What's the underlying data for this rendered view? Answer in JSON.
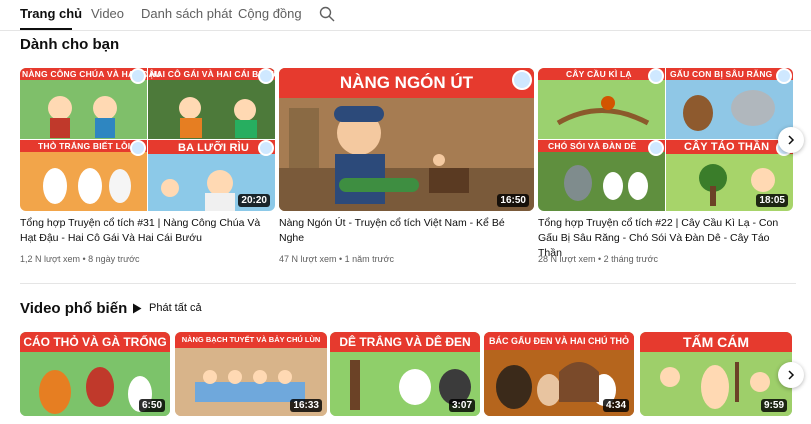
{
  "tabs": [
    {
      "label": "Trang chủ",
      "active": true
    },
    {
      "label": "Video",
      "active": false
    },
    {
      "label": "Danh sách phát",
      "active": false
    },
    {
      "label": "Cộng đồng",
      "active": false
    }
  ],
  "search_icon": "search-icon",
  "for_you": {
    "title": "Dành cho bạn",
    "videos": [
      {
        "title": "Tổng hợp Truyện cổ tích #31 | Nàng Công Chúa Và Hạt Đậu - Hai Cô Gái Và Hai Cái Bướu",
        "meta": "1,2 N lượt xem • 8 ngày trước",
        "duration": "20:20",
        "panels": [
          "NÀNG CÔNG CHÚA VÀ HẠT ĐẬU",
          "HAI CÔ GÁI VÀ HAI CÁI BƯỚU",
          "THỎ TRẮNG BIẾT LỖI",
          "BA LƯỠI RÌU"
        ]
      },
      {
        "title": "Nàng Ngón Út - Truyện cổ tích Việt Nam - Kể Bé Nghe",
        "meta": "47 N lượt xem • 1 năm trước",
        "duration": "16:50",
        "banner": "NÀNG NGÓN ÚT"
      },
      {
        "title": "Tổng hợp Truyện cổ tích #22 | Cây Cầu Kì Lạ - Con Gấu Bị Sâu Răng - Chó Sói Và Đàn Dê - Cây Táo Thần",
        "meta": "28 N lượt xem • 2 tháng trước",
        "duration": "18:05",
        "panels": [
          "CÂY CẦU KÌ LẠ",
          "GẤU CON BỊ SÂU RĂNG",
          "CHÓ SÓI VÀ ĐÀN DÊ",
          "CÂY TÁO THẦN"
        ]
      }
    ]
  },
  "popular": {
    "title": "Video phổ biến",
    "play_all_label": "Phát tất cả",
    "videos": [
      {
        "banner": "CÁO THỎ VÀ GÀ TRỐNG",
        "duration": "6:50"
      },
      {
        "banner": "NÀNG BẠCH TUYẾT VÀ BẢY CHÚ LÙN",
        "duration": "16:33"
      },
      {
        "banner": "DÊ TRẮNG VÀ DÊ ĐEN",
        "duration": "3:07"
      },
      {
        "banner": "BÁC GẤU ĐEN VÀ HAI CHÚ THỎ",
        "duration": "4:34"
      },
      {
        "banner": "TẤM CÁM",
        "duration": "9:59"
      }
    ]
  },
  "colors": {
    "banner_red": "#e63a2e",
    "text": "#0f0f0f",
    "meta": "#606060"
  }
}
